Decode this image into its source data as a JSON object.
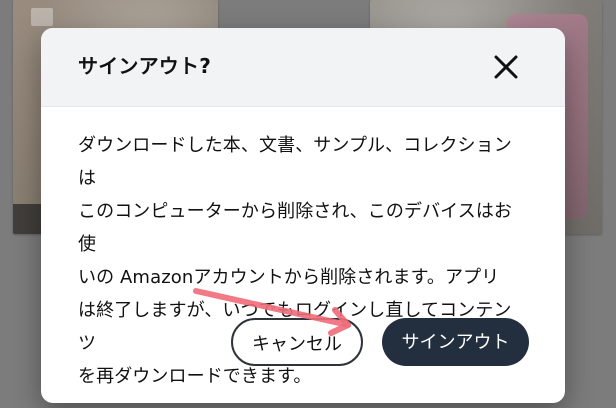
{
  "dialog": {
    "title": "サインアウト?",
    "body_lines": [
      "ダウンロードした本、文書、サンプル、コレクションは",
      "このコンピューターから削除され、このデバイスはお使",
      "いの Amazonアカウントから削除されます。アプリ",
      "は終了しますが、いつでもログインし直してコンテンツ",
      "を再ダウンロードできます。"
    ],
    "buttons": {
      "cancel_label": "キャンセル",
      "signout_label": "サインアウト"
    }
  },
  "icons": {
    "close": "close-icon",
    "annotation_arrow": "arrow-icon"
  },
  "colors": {
    "overlay": "#7b7b7b",
    "dialog_header_bg": "#f2f3f5",
    "primary_button": "#232f3e",
    "primary_button_text": "#ffffff",
    "cancel_border": "#2f343a",
    "annotation_arrow": "#f06b79"
  }
}
